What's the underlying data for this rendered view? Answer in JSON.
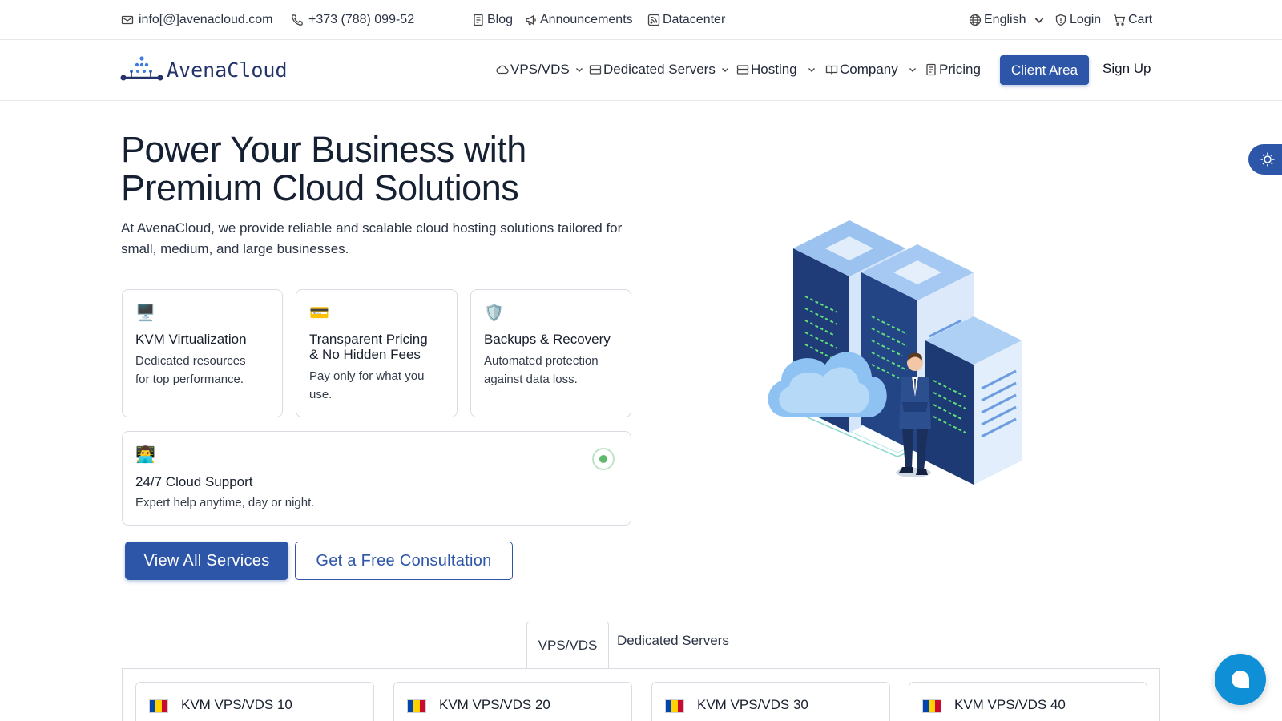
{
  "topbar": {
    "email": "info[@]avenacloud.com",
    "phone": "+373 (788) 099-52",
    "blog": "Blog",
    "announcements": "Announcements",
    "datacenter": "Datacenter",
    "language": "English",
    "login": "Login",
    "cart": "Cart"
  },
  "header": {
    "logo_text": "AvenaCloud",
    "nav": {
      "vps": "VPS/VDS",
      "dedicated": "Dedicated Servers",
      "hosting": "Hosting",
      "company": "Company",
      "pricing": "Pricing"
    },
    "client_area": "Client Area",
    "sign_up": "Sign Up"
  },
  "hero": {
    "title_line1": "Power Your Business with",
    "title_line2": "Premium Cloud Solutions",
    "subtitle": "At AvenaCloud, we provide reliable and scalable cloud hosting solutions tailored for small, medium, and large businesses."
  },
  "features": [
    {
      "emoji": "🖥️",
      "title": "KVM Virtualization",
      "desc_line1": "Dedicated resources",
      "desc_line2": "for top performance."
    },
    {
      "emoji": "💳",
      "title_line1": "Transparent Pricing",
      "title_line2": "& No Hidden Fees",
      "desc_line1": "Pay only for what you",
      "desc_line2": "use."
    },
    {
      "emoji": "🛡️",
      "title": "Backups & Recovery",
      "desc_line1": "Automated protection",
      "desc_line2": "against data loss."
    },
    {
      "emoji": "👨‍💻",
      "title": "24/7 Cloud Support",
      "desc": "Expert help anytime, day or night."
    }
  ],
  "actions": {
    "primary": "View All Services",
    "secondary": "Get a Free Consultation"
  },
  "tabs": {
    "active": "VPS/VDS",
    "other": "Dedicated Servers"
  },
  "plans": [
    {
      "name": "KVM VPS/VDS 10"
    },
    {
      "name": "KVM VPS/VDS 20"
    },
    {
      "name": "KVM VPS/VDS 30"
    },
    {
      "name": "KVM VPS/VDS 40"
    }
  ],
  "colors": {
    "brand": "#2d55a8",
    "chat": "#0f8fd6",
    "flag_blue": "#0046ae",
    "flag_yellow": "#ffd200",
    "flag_red": "#cc092f"
  },
  "icons": [
    "mail-icon",
    "phone-icon",
    "blog-icon",
    "megaphone-icon",
    "rss-icon",
    "globe-icon",
    "shield-icon",
    "cart-icon",
    "cloud-icon",
    "server-icon",
    "book-icon",
    "document-icon",
    "sun-icon",
    "chat-icon"
  ]
}
